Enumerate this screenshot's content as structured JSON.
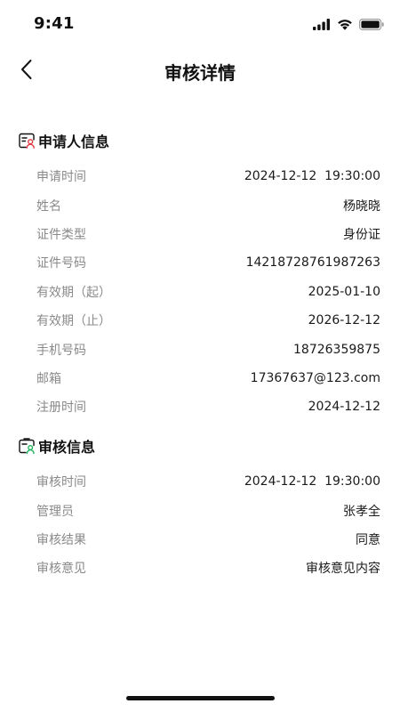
{
  "status_bar": {
    "time": "9:41",
    "icons": [
      "signal-icon",
      "wifi-icon",
      "battery-icon"
    ]
  },
  "nav": {
    "title": "审核详情",
    "back_icon": "chevron-left-icon"
  },
  "applicant": {
    "title": "申请人信息",
    "icon": "applicant-card-icon",
    "rows": [
      {
        "label": "申请时间",
        "value": "2024-12-12  19:30:00"
      },
      {
        "label": "姓名",
        "value": "杨晓晓"
      },
      {
        "label": "证件类型",
        "value": "身份证"
      },
      {
        "label": "证件号码",
        "value": "14218728761987263"
      },
      {
        "label": "有效期（起）",
        "value": "2025-01-10"
      },
      {
        "label": "有效期（止）",
        "value": "2026-12-12"
      },
      {
        "label": "手机号码",
        "value": "18726359875"
      },
      {
        "label": "邮箱",
        "value": "17367637@123.com"
      },
      {
        "label": "注册时间",
        "value": "2024-12-12"
      }
    ]
  },
  "review": {
    "title": "审核信息",
    "icon": "review-card-icon",
    "rows": [
      {
        "label": "审核时间",
        "value": "2024-12-12  19:30:00"
      },
      {
        "label": "管理员",
        "value": "张孝全"
      },
      {
        "label": "审核结果",
        "value": "同意"
      },
      {
        "label": "审核意见",
        "value": "审核意见内容"
      }
    ]
  },
  "colors": {
    "accent_red": "#e0393e",
    "accent_green": "#1bb35a",
    "label_gray": "#8a8a8a",
    "text_dark": "#1a1a1a"
  }
}
